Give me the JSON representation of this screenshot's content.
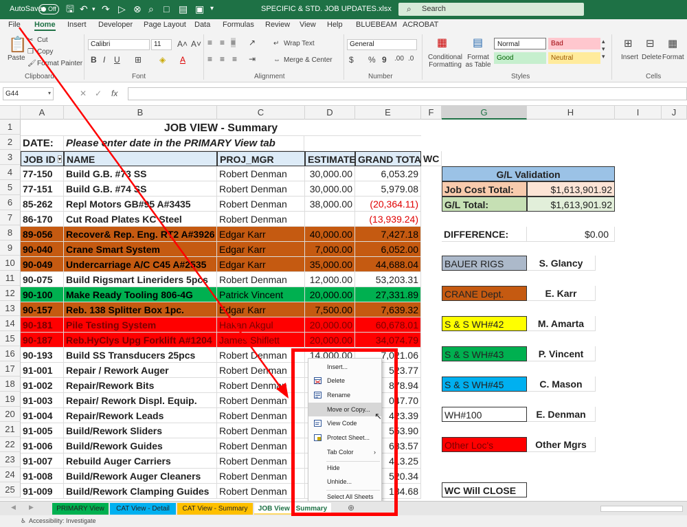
{
  "titlebar": {
    "autosave_label": "AutoSave",
    "autosave_state": "Off",
    "filename": "SPECIFIC & STD. JOB UPDATES.xlsx",
    "search_placeholder": "Search"
  },
  "menu": [
    "File",
    "Home",
    "Insert",
    "Developer",
    "Page Layout",
    "Data",
    "Formulas",
    "Review",
    "View",
    "Help",
    "BLUEBEAM",
    "ACROBAT"
  ],
  "ribbon": {
    "clipboard": {
      "paste": "Paste",
      "cut": "Cut",
      "copy": "Copy",
      "format_painter": "Format Painter",
      "label": "Clipboard"
    },
    "font": {
      "name": "Calibri",
      "size": "11",
      "label": "Font"
    },
    "alignment": {
      "wrap_text": "Wrap Text",
      "merge_center": "Merge & Center",
      "label": "Alignment"
    },
    "number": {
      "format": "General",
      "label": "Number"
    },
    "styles": {
      "conditional": "Conditional Formatting",
      "format_table": "Format as Table",
      "normal": "Normal",
      "bad": "Bad",
      "good": "Good",
      "neutral": "Neutral",
      "label": "Styles"
    },
    "cells": {
      "insert": "Insert",
      "delete": "Delete",
      "format": "Format",
      "label": "Cells"
    }
  },
  "formula_bar": {
    "name_box": "G44",
    "fx": "fx"
  },
  "columns": [
    "A",
    "B",
    "C",
    "D",
    "E",
    "F",
    "G",
    "H",
    "I",
    "J"
  ],
  "rows": [
    "1",
    "2",
    "3",
    "4",
    "5",
    "6",
    "7",
    "8",
    "9",
    "10",
    "11",
    "12",
    "13",
    "14",
    "15",
    "16",
    "17",
    "18",
    "19",
    "20",
    "21",
    "22",
    "23",
    "24",
    "25"
  ],
  "sheet": {
    "title": "JOB VIEW - Summary",
    "date_label": "DATE:",
    "date_note": "Please enter date in the PRIMARY View tab",
    "headers": {
      "job_id": "JOB ID",
      "name": "NAME",
      "proj_mgr": "PROJ_MGR",
      "estimate": "ESTIMATE",
      "grand_total": "GRAND TOTAL",
      "wc": "WC"
    },
    "jobs": [
      {
        "id": "77-150",
        "name": "Build G.B. #73 SS",
        "mgr": "Robert Denman",
        "estimate": "30,000.00",
        "total": "6,053.29"
      },
      {
        "id": "77-151",
        "name": "Build G.B. #74 SS",
        "mgr": "Robert Denman",
        "estimate": "30,000.00",
        "total": "5,979.08"
      },
      {
        "id": "85-262",
        "name": "Repl Motors GB#95 A#3435",
        "mgr": "Robert Denman",
        "estimate": "38,000.00",
        "total": "(20,364.11)"
      },
      {
        "id": "86-170",
        "name": "Cut Road Plates KC Steel",
        "mgr": "Robert Denman",
        "estimate": "",
        "total": "(13,939.24)"
      },
      {
        "id": "89-056",
        "name": "Recover& Rep. Eng. RT2 A#3926",
        "mgr": "Edgar Karr",
        "estimate": "40,000.00",
        "total": "7,427.18"
      },
      {
        "id": "90-040",
        "name": "Crane Smart System",
        "mgr": "Edgar Karr",
        "estimate": "7,000.00",
        "total": "6,052.00"
      },
      {
        "id": "90-049",
        "name": " Undercarriage A/C C45 A#2535",
        "mgr": "Edgar Karr",
        "estimate": "35,000.00",
        "total": "44,688.04"
      },
      {
        "id": "90-075",
        "name": "Build Rigsmart Lineriders 5pcs",
        "mgr": "Robert Denman",
        "estimate": "12,000.00",
        "total": "53,203.31"
      },
      {
        "id": "90-100",
        "name": "Make Ready Tooling 806-4G",
        "mgr": "Patrick Vincent",
        "estimate": "20,000.00",
        "total": "27,331.89"
      },
      {
        "id": "90-157",
        "name": "Reb. 138 Splitter Box 1pc.",
        "mgr": "Edgar Karr",
        "estimate": "7,500.00",
        "total": "7,639.32"
      },
      {
        "id": "90-181",
        "name": "Pile Testing System",
        "mgr": "Hakan Akgul",
        "estimate": "20,000.00",
        "total": "60,678.01"
      },
      {
        "id": "90-187",
        "name": "Reb.HyClys Upg Forklift A#1204",
        "mgr": "James Shiflett",
        "estimate": "20,000.00",
        "total": "34,074.79"
      },
      {
        "id": "90-193",
        "name": "Build  SS Transducers 25pcs",
        "mgr": "Robert Denman",
        "estimate": "14,000.00",
        "total": "7,021.06"
      },
      {
        "id": "91-001",
        "name": "Repair / Rework Auger",
        "mgr": "Robert Denman",
        "estimate": "",
        "total": "523.77"
      },
      {
        "id": "91-002",
        "name": "Repair/Rework Bits",
        "mgr": "Robert Denman",
        "estimate": "",
        "total": "878.94"
      },
      {
        "id": "91-003",
        "name": "Repair/ Rework Displ. Equip.",
        "mgr": "Robert Denman",
        "estimate": "",
        "total": "047.70"
      },
      {
        "id": "91-004",
        "name": "Repair/Rework Leads",
        "mgr": "Robert Denman",
        "estimate": "",
        "total": "423.39"
      },
      {
        "id": "91-005",
        "name": "Build/Rework Sliders",
        "mgr": "Robert Denman",
        "estimate": "",
        "total": "553.90"
      },
      {
        "id": "91-006",
        "name": "Build/Rework Guides",
        "mgr": "Robert Denman",
        "estimate": "",
        "total": "683.57"
      },
      {
        "id": "91-007",
        "name": "Rebuild Auger Carriers",
        "mgr": "Robert Denman",
        "estimate": "",
        "total": "413.25"
      },
      {
        "id": "91-008",
        "name": "Build/Rework Auger Cleaners",
        "mgr": "Robert Denman",
        "estimate": "",
        "total": "520.34"
      },
      {
        "id": "91-009",
        "name": "Build/Rework Clamping Guides",
        "mgr": "Robert Denman",
        "estimate": "",
        "total": "134.68"
      }
    ],
    "gl": {
      "title": "G/L Validation",
      "job_cost_label": "Job Cost Total:",
      "job_cost_value": "$1,613,901.92",
      "gl_total_label": "G/L Total:",
      "gl_total_value": "$1,613,901.92",
      "difference_label": "DIFFERENCE:",
      "difference_value": "$0.00"
    },
    "legend": [
      {
        "label": "BAUER RIGS",
        "mgr": "S. Glancy"
      },
      {
        "label": "CRANE Dept.",
        "mgr": "E. Karr"
      },
      {
        "label": "S & S WH#42",
        "mgr": "M. Amarta"
      },
      {
        "label": "S & S WH#43",
        "mgr": "P. Vincent"
      },
      {
        "label": "S & S WH#45",
        "mgr": "C. Mason"
      },
      {
        "label": "WH#100",
        "mgr": "E. Denman"
      },
      {
        "label": "Other Loc's",
        "mgr": "Other Mgrs"
      }
    ],
    "wc_note": "WC  Will CLOSE"
  },
  "context_menu": [
    "Insert...",
    "Delete",
    "Rename",
    "Move or Copy...",
    "View Code",
    "Protect Sheet...",
    "Tab Color",
    "Hide",
    "Unhide...",
    "Select All Sheets"
  ],
  "sheet_tabs": [
    "PRIMARY View",
    "CAT View - Detail",
    "CAT View - Summary",
    "JOB View - Summary"
  ],
  "status": {
    "accessibility": "Accessibility: Investigate"
  },
  "colors": {
    "excel_green": "#1e7145",
    "orange": "#c55a11",
    "green": "#00b050",
    "red": "#ff0000",
    "yellow": "#ffff00",
    "blue_grey": "#acb9ca",
    "sky": "#00b0f0",
    "header_blue": "#ddebf7",
    "annotation_red": "#ff0000"
  }
}
